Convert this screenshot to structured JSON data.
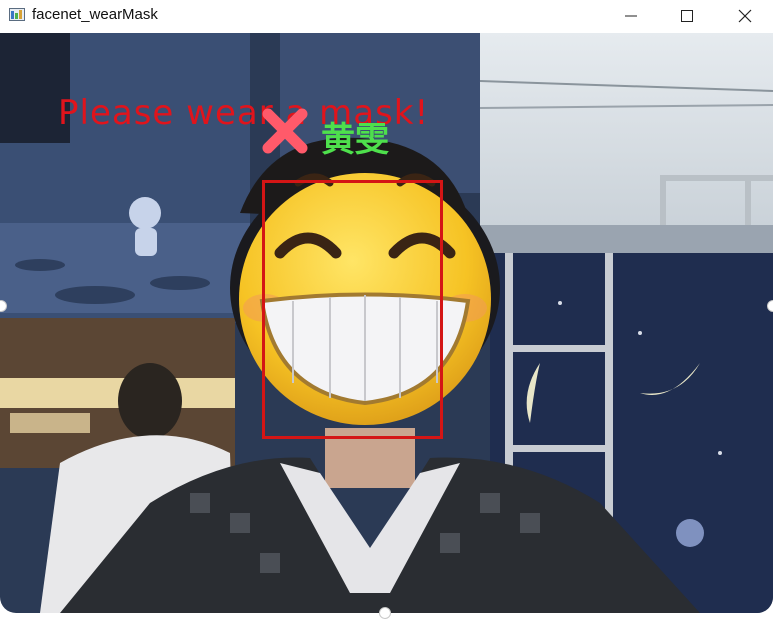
{
  "window": {
    "title": "facenet_wearMask",
    "controls": {
      "minimize": "minimize-icon",
      "maximize": "maximize-icon",
      "close": "close-icon"
    }
  },
  "overlay": {
    "warning_text": "Please wear a mask!",
    "status_icon": "x-mark-icon",
    "person_name": "黄雯",
    "colors": {
      "warning": "#e0141c",
      "name": "#4ee04c",
      "face_box": "#d41515"
    }
  }
}
